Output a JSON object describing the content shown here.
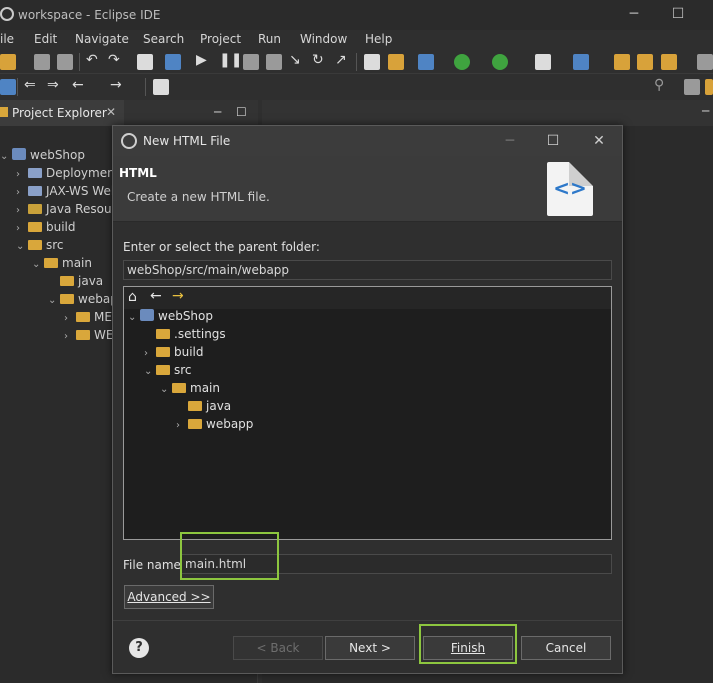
{
  "ide": {
    "title": "workspace - Eclipse IDE",
    "menu": [
      "ile",
      "Edit",
      "Navigate",
      "Search",
      "Project",
      "Run",
      "Window",
      "Help"
    ]
  },
  "explorer": {
    "tab_label": "Project Explorer",
    "tree": [
      {
        "label": "webShop",
        "indent": 0,
        "chevron": "down",
        "icon": "project"
      },
      {
        "label": "Deployment",
        "indent": 1,
        "chevron": "right",
        "icon": "deploy"
      },
      {
        "label": "JAX-WS Web",
        "indent": 1,
        "chevron": "right",
        "icon": "ws"
      },
      {
        "label": "Java Resourc",
        "indent": 1,
        "chevron": "right",
        "icon": "java-res"
      },
      {
        "label": "build",
        "indent": 1,
        "chevron": "right",
        "icon": "folder"
      },
      {
        "label": "src",
        "indent": 1,
        "chevron": "down",
        "icon": "folder"
      },
      {
        "label": "main",
        "indent": 2,
        "chevron": "down",
        "icon": "folder"
      },
      {
        "label": "java",
        "indent": 3,
        "chevron": "",
        "icon": "folder"
      },
      {
        "label": "webapp",
        "indent": 3,
        "chevron": "down",
        "icon": "folder"
      },
      {
        "label": "MET",
        "indent": 4,
        "chevron": "right",
        "icon": "folder"
      },
      {
        "label": "WEI",
        "indent": 4,
        "chevron": "right",
        "icon": "folder"
      }
    ]
  },
  "dialog": {
    "title": "New HTML File",
    "header_title": "HTML",
    "header_subtitle": "Create a new HTML file.",
    "banner_glyph": "<>",
    "parent_folder_label": "Enter or select the parent folder:",
    "parent_folder_value": "webShop/src/main/webapp",
    "folder_tree": [
      {
        "label": "webShop",
        "indent": 0,
        "chevron": "down",
        "icon": "project"
      },
      {
        "label": ".settings",
        "indent": 1,
        "chevron": "",
        "icon": "folder"
      },
      {
        "label": "build",
        "indent": 1,
        "chevron": "right",
        "icon": "folder"
      },
      {
        "label": "src",
        "indent": 1,
        "chevron": "down",
        "icon": "folder"
      },
      {
        "label": "main",
        "indent": 2,
        "chevron": "down",
        "icon": "folder"
      },
      {
        "label": "java",
        "indent": 3,
        "chevron": "",
        "icon": "folder"
      },
      {
        "label": "webapp",
        "indent": 3,
        "chevron": "right",
        "icon": "folder"
      }
    ],
    "file_name_label": "File name:",
    "file_name_value": "main.html",
    "advanced_label": "Advanced >>",
    "buttons": {
      "back": "< Back",
      "next": "Next >",
      "finish": "Finish",
      "cancel": "Cancel"
    },
    "help_glyph": "?"
  },
  "colors": {
    "highlight": "#8dc63f",
    "folder": "#d9a73b",
    "banner_accent": "#2d78c9"
  }
}
